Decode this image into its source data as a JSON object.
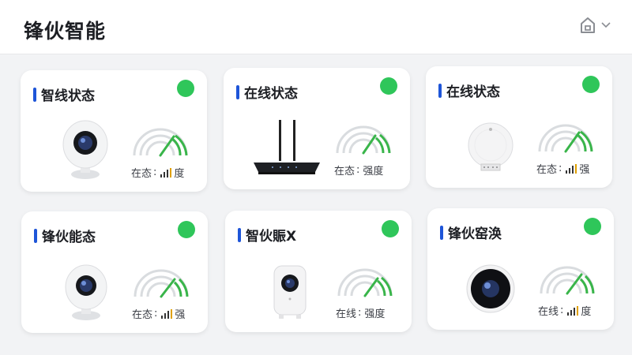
{
  "header": {
    "title": "锋伙智能",
    "home_icon": "home-icon",
    "dropdown_icon": "chevron-down-icon"
  },
  "colors": {
    "accent": "#1e55d8",
    "online": "#2fc65a",
    "gauge_track": "#d9dcdf",
    "gauge_fill": "#39b54a"
  },
  "cards": [
    {
      "title": "智线状态",
      "device": "camera",
      "status_label": "在态",
      "status_value": "度",
      "signal_icon": "signal-bars-icon",
      "online": true
    },
    {
      "title": "在线状态",
      "device": "router",
      "status_label": "在态",
      "status_value": "强度",
      "signal_icon": "",
      "online": true
    },
    {
      "title": "在线状态",
      "device": "sensor",
      "status_label": "在态",
      "status_value": "强",
      "signal_icon": "signal-bars-icon",
      "online": true
    },
    {
      "title": "锋伙能态",
      "device": "camera",
      "status_label": "在态",
      "status_value": "强",
      "signal_icon": "signal-bars-icon",
      "online": true
    },
    {
      "title": "智伙賑Ⅹ",
      "device": "camera-box",
      "status_label": "在线",
      "status_value": "强度",
      "signal_icon": "",
      "online": true
    },
    {
      "title": "锋伙窑涣",
      "device": "round-camera",
      "status_label": "在线",
      "status_value": "度",
      "signal_icon": "signal-bars-icon",
      "online": true
    }
  ]
}
